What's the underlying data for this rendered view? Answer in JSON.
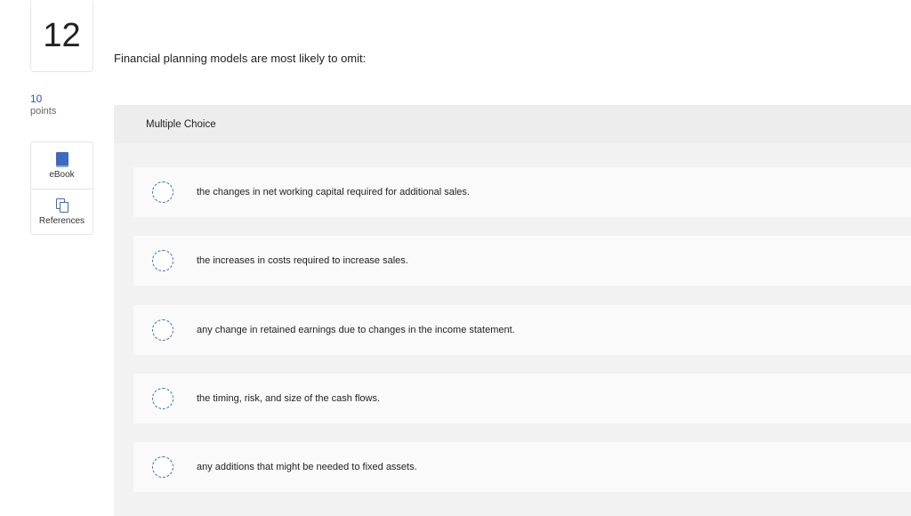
{
  "question": {
    "number": "12",
    "points_value": "10",
    "points_label": "points",
    "prompt": "Financial planning models are most likely to omit:"
  },
  "tools": [
    {
      "label": "eBook",
      "icon": "ebook-icon"
    },
    {
      "label": "References",
      "icon": "references-icon"
    }
  ],
  "answer_panel": {
    "type_label": "Multiple Choice",
    "options": [
      {
        "text": "the changes in net working capital required for additional sales.",
        "selected": false
      },
      {
        "text": "the increases in costs required to increase sales.",
        "selected": false
      },
      {
        "text": "any change in retained earnings due to changes in the income statement.",
        "selected": false
      },
      {
        "text": "the timing, risk, and size of the cash flows.",
        "selected": false
      },
      {
        "text": "any additions that might be needed to fixed assets.",
        "selected": false
      }
    ]
  },
  "colors": {
    "accent": "#3a6bc1",
    "points_value": "#2b5aa0",
    "panel_bg": "#f2f2f2",
    "option_bg": "#fafafa"
  }
}
